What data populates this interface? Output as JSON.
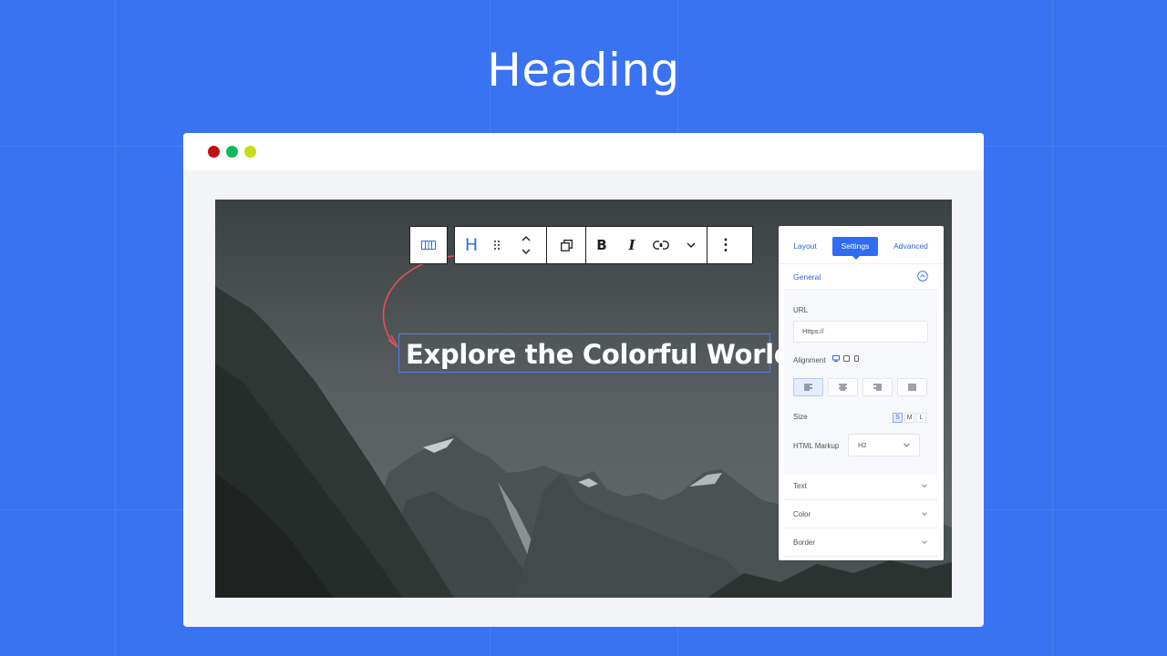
{
  "page": {
    "title": "Heading",
    "background": "#3a73f1"
  },
  "browser": {
    "dots": [
      "#c0100f",
      "#12b85a",
      "#c7dc1a"
    ]
  },
  "canvas": {
    "heading_text": "Explore the Colorful World"
  },
  "toolbar": {
    "groups": [
      [
        "columns-icon"
      ],
      [
        "heading-h-icon",
        "drag-handle-icon",
        "move-up-down-icon"
      ],
      [
        "duplicate-icon"
      ],
      [
        "bold-icon",
        "italic-icon",
        "link-icon",
        "more-chevron-icon"
      ],
      [
        "more-options-icon"
      ]
    ],
    "heading_glyph": "H",
    "bold_glyph": "B",
    "italic_glyph": "I",
    "more_glyph": "⋮"
  },
  "panel": {
    "tabs": [
      "Layout",
      "Settings",
      "Advanced"
    ],
    "active_tab": "Settings",
    "general": {
      "title": "General",
      "url_label": "URL",
      "url_placeholder": "Https://",
      "alignment_label": "Alignment",
      "alignment_options": [
        "left",
        "center",
        "right",
        "justify"
      ],
      "alignment_active": "left",
      "size_label": "Size",
      "size_options": [
        "S",
        "M",
        "L"
      ],
      "size_active": "S",
      "markup_label": "HTML Markup",
      "markup_value": "H2"
    },
    "sections": [
      "Text",
      "Color",
      "Border"
    ]
  },
  "accent_color": "#2f6cf2"
}
